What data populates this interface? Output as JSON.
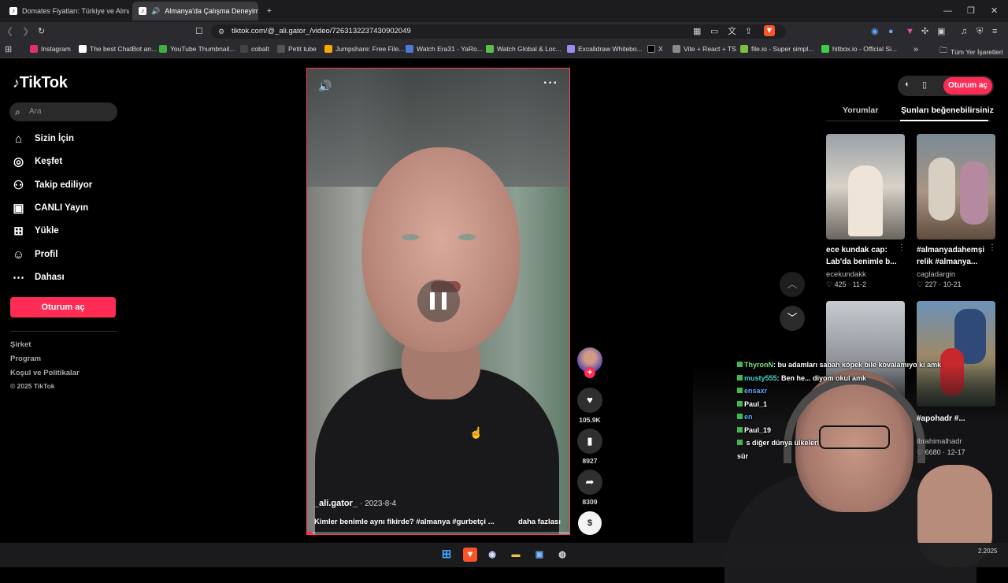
{
  "browser": {
    "tabs": [
      {
        "title": "Domates Fiyatları: Türkiye ve Almany",
        "active": false
      },
      {
        "title": "Almanya'da Çalışma Deneyim",
        "active": true
      }
    ],
    "new_tab_icon": "plus-icon",
    "url": "tiktok.com/@_ali.gator_/video/7263132237430902049",
    "bookmarks": [
      "Instagram",
      "The best ChatBot an...",
      "YouTube Thumbnail...",
      "cobalt",
      "Petit tube",
      "Jumpshare: Free File...",
      "Watch Era31 - YaRo...",
      "Watch Global & Loc...",
      "Excalidraw Whitebo...",
      "X",
      "Vite + React + TS",
      "file.io - Super simpl...",
      "hitbox.io - Official Si..."
    ],
    "all_bookmarks": "Tüm Yer İşaretleri"
  },
  "sidebar": {
    "logo": "TikTok",
    "search_placeholder": "Ara",
    "nav": [
      {
        "label": "Sizin İçin",
        "icon": "home-icon"
      },
      {
        "label": "Keşfet",
        "icon": "compass-icon"
      },
      {
        "label": "Takip ediliyor",
        "icon": "user-plus-icon"
      },
      {
        "label": "CANLI Yayın",
        "icon": "live-tv-icon"
      },
      {
        "label": "Yükle",
        "icon": "upload-plus-icon"
      },
      {
        "label": "Profil",
        "icon": "person-icon"
      },
      {
        "label": "Dahası",
        "icon": "more-dots-icon"
      }
    ],
    "login": "Oturum aç",
    "footer": [
      "Şirket",
      "Program",
      "Koşul ve Politikalar",
      "© 2025 TikTok"
    ]
  },
  "video": {
    "author": "_ali.gator_",
    "date": "· 2023-8-4",
    "caption": "Kimler benimle aynı fikirde? #almanya #gurbetçi ...",
    "more": "daha fazlası",
    "progress_fraction": 0.02,
    "state": "paused"
  },
  "actions": {
    "likes": "105.9K",
    "saves": "8927",
    "shares": "8309",
    "coin_label": "$"
  },
  "right_panel": {
    "login": "Oturum aç",
    "tabs": [
      "Yorumlar",
      "Şunları beğenebilirsiniz"
    ],
    "active_tab": 1,
    "videos": [
      {
        "title": "ece kundak cap: Lab'da benimle b...",
        "user": "ecekundakk",
        "likes": "425",
        "date": "11-2"
      },
      {
        "title": "#almanyadahemşi relik #almanya...",
        "user": "cagladargin",
        "likes": "227",
        "date": "10-21"
      },
      {
        "title": "",
        "user": "",
        "likes": "",
        "date": ""
      },
      {
        "title": "#apohadr #...",
        "user": "ibrahimalhadr",
        "likes": "6680",
        "date": "12-17"
      }
    ]
  },
  "chat": [
    {
      "user": "ThyronN",
      "color": "#7be37b",
      "text": ": bu adamları sabah köpek bile kovalamıyo ki amk"
    },
    {
      "user": "musty555",
      "color": "#3fd6c6",
      "text": ": Ben he...                  diyom okul amk"
    },
    {
      "user": "ensaxr",
      "color": "#5aa7ff",
      "text": ""
    },
    {
      "user": "Paul_1",
      "color": "#ffffff",
      "text": ""
    },
    {
      "user": "en",
      "color": "#5aa7ff",
      "text": ""
    },
    {
      "user": "Paul_19",
      "color": "#ffffff",
      "text": ""
    },
    {
      "user": "",
      "color": "#5aa7ff",
      "text": "                              s diğer dünya ülkeleri"
    },
    {
      "user": "",
      "color": "#ffffff",
      "text": "sür"
    }
  ],
  "taskbar": {
    "clock_time": "",
    "clock_date": "2.2025"
  }
}
